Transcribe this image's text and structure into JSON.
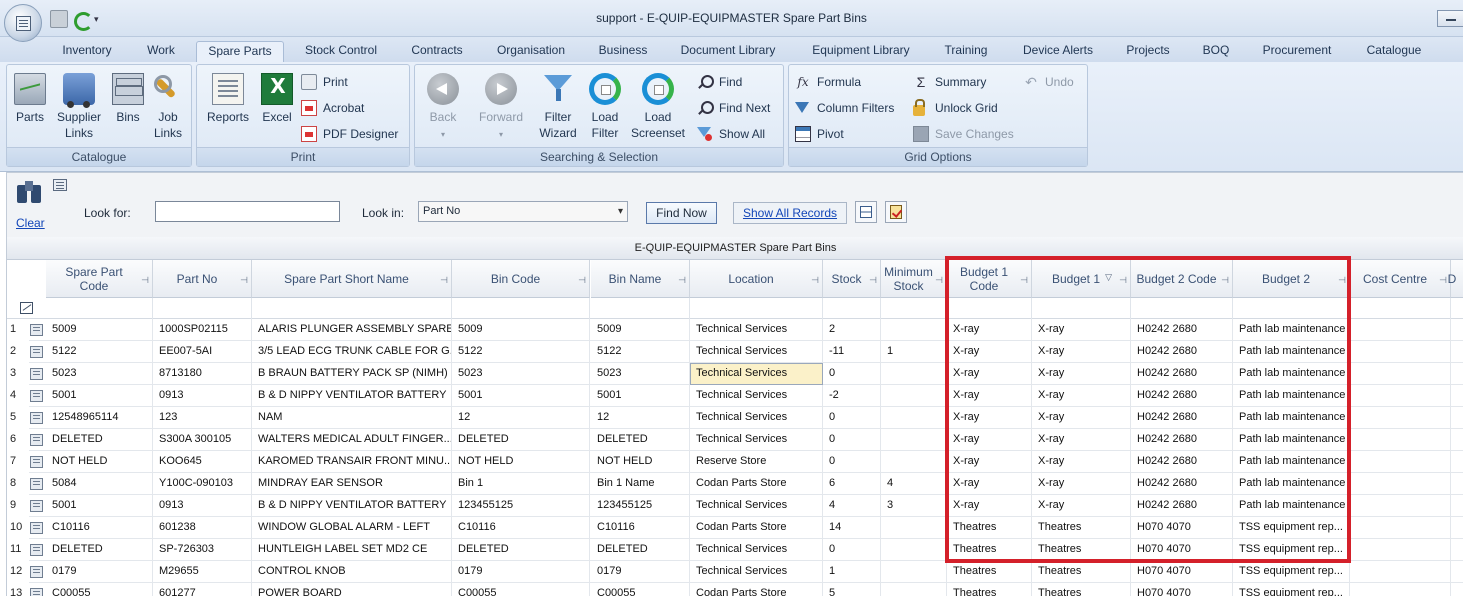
{
  "window": {
    "title": "support - E-QUIP-EQUIPMASTER Spare Part Bins"
  },
  "tabs": [
    {
      "label": "Inventory"
    },
    {
      "label": "Work"
    },
    {
      "label": "Spare Parts"
    },
    {
      "label": "Stock Control"
    },
    {
      "label": "Contracts"
    },
    {
      "label": "Organisation"
    },
    {
      "label": "Business"
    },
    {
      "label": "Document Library"
    },
    {
      "label": "Equipment Library"
    },
    {
      "label": "Training"
    },
    {
      "label": "Device Alerts"
    },
    {
      "label": "Projects"
    },
    {
      "label": "BOQ"
    },
    {
      "label": "Procurement"
    },
    {
      "label": "Catalogue"
    }
  ],
  "active_tab": "Spare Parts",
  "ribbon": {
    "catalogue": {
      "label": "Catalogue",
      "parts": "Parts",
      "supplier_links_1": "Supplier",
      "supplier_links_2": "Links",
      "bins": "Bins",
      "job_links_1": "Job",
      "job_links_2": "Links"
    },
    "print": {
      "label": "Print",
      "reports": "Reports",
      "excel": "Excel",
      "print": "Print",
      "acrobat": "Acrobat",
      "pdf_designer": "PDF Designer"
    },
    "searching": {
      "label": "Searching & Selection",
      "back": "Back",
      "forward": "Forward",
      "filter_wizard_1": "Filter",
      "filter_wizard_2": "Wizard",
      "load_filter_1": "Load",
      "load_filter_2": "Filter",
      "load_screenset_1": "Load",
      "load_screenset_2": "Screenset",
      "find": "Find",
      "find_next": "Find Next",
      "show_all": "Show All"
    },
    "grid_options": {
      "label": "Grid Options",
      "formula": "Formula",
      "column_filters": "Column Filters",
      "pivot": "Pivot",
      "summary": "Summary",
      "unlock_grid": "Unlock Grid",
      "save_changes": "Save Changes",
      "undo": "Undo"
    }
  },
  "search": {
    "clear": "Clear",
    "look_for_label": "Look for:",
    "look_for_value": "",
    "look_in_label": "Look in:",
    "look_in_value": "Part No",
    "find_now": "Find Now",
    "show_all_records": "Show All Records"
  },
  "grid": {
    "caption": "E-QUIP-EQUIPMASTER Spare Part Bins",
    "columns": [
      "Spare Part Code",
      "Part No",
      "Spare Part Short Name",
      "Bin Code",
      "Bin Name",
      "Location",
      "Stock",
      "Minimum Stock",
      "Budget 1 Code",
      "Budget 1",
      "Budget 2 Code",
      "Budget 2",
      "Cost Centre",
      "D"
    ],
    "rows": [
      {
        "n": "1",
        "code": "5009",
        "part_no": "1000SP02115",
        "name": "ALARIS PLUNGER ASSEMBLY SPARE...",
        "bin_code": "5009",
        "bin_name": "5009",
        "location": "Technical Services",
        "stock": "2",
        "min": "",
        "b1code": "X-ray",
        "b1": "X-ray",
        "b2code": "H0242 2680",
        "b2": "Path lab maintenance"
      },
      {
        "n": "2",
        "code": "5122",
        "part_no": "EE007-5AI",
        "name": "3/5 LEAD ECG TRUNK CABLE FOR G...",
        "bin_code": "5122",
        "bin_name": "5122",
        "location": "Technical Services",
        "stock": "-11",
        "min": "1",
        "b1code": "X-ray",
        "b1": "X-ray",
        "b2code": "H0242 2680",
        "b2": "Path lab maintenance"
      },
      {
        "n": "3",
        "code": "5023",
        "part_no": "8713180",
        "name": "B BRAUN BATTERY PACK SP (NIMH)",
        "bin_code": "5023",
        "bin_name": "5023",
        "location": "Technical Services",
        "stock": "0",
        "min": "",
        "b1code": "X-ray",
        "b1": "X-ray",
        "b2code": "H0242 2680",
        "b2": "Path lab maintenance"
      },
      {
        "n": "4",
        "code": "5001",
        "part_no": "0913",
        "name": "B & D NIPPY VENTILATOR BATTERY",
        "bin_code": "5001",
        "bin_name": "5001",
        "location": "Technical Services",
        "stock": "-2",
        "min": "",
        "b1code": "X-ray",
        "b1": "X-ray",
        "b2code": "H0242 2680",
        "b2": "Path lab maintenance"
      },
      {
        "n": "5",
        "code": "12548965114",
        "part_no": "123",
        "name": "NAM",
        "bin_code": "12",
        "bin_name": "12",
        "location": "Technical Services",
        "stock": "0",
        "min": "",
        "b1code": "X-ray",
        "b1": "X-ray",
        "b2code": "H0242 2680",
        "b2": "Path lab maintenance"
      },
      {
        "n": "6",
        "code": "DELETED",
        "part_no": "S300A 300105",
        "name": "WALTERS MEDICAL ADULT FINGER...",
        "bin_code": "DELETED",
        "bin_name": "DELETED",
        "location": "Technical Services",
        "stock": "0",
        "min": "",
        "b1code": "X-ray",
        "b1": "X-ray",
        "b2code": "H0242 2680",
        "b2": "Path lab maintenance"
      },
      {
        "n": "7",
        "code": "NOT HELD",
        "part_no": "KOO645",
        "name": "KAROMED TRANSAIR FRONT MINU...",
        "bin_code": "NOT HELD",
        "bin_name": "NOT HELD",
        "location": "Reserve Store",
        "stock": "0",
        "min": "",
        "b1code": "X-ray",
        "b1": "X-ray",
        "b2code": "H0242 2680",
        "b2": "Path lab maintenance"
      },
      {
        "n": "8",
        "code": "5084",
        "part_no": "Y100C-090103",
        "name": "MINDRAY EAR SENSOR",
        "bin_code": "Bin 1",
        "bin_name": "Bin 1 Name",
        "location": "Codan Parts Store",
        "stock": "6",
        "min": "4",
        "b1code": "X-ray",
        "b1": "X-ray",
        "b2code": "H0242 2680",
        "b2": "Path lab maintenance"
      },
      {
        "n": "9",
        "code": "5001",
        "part_no": "0913",
        "name": "B & D NIPPY VENTILATOR BATTERY",
        "bin_code": "123455125",
        "bin_name": "123455125",
        "location": "Technical Services",
        "stock": "4",
        "min": "3",
        "b1code": "X-ray",
        "b1": "X-ray",
        "b2code": "H0242 2680",
        "b2": "Path lab maintenance"
      },
      {
        "n": "10",
        "code": "C10116",
        "part_no": "601238",
        "name": "WINDOW GLOBAL ALARM - LEFT",
        "bin_code": "C10116",
        "bin_name": "C10116",
        "location": "Codan Parts Store",
        "stock": "14",
        "min": "",
        "b1code": "Theatres",
        "b1": "Theatres",
        "b2code": "H070 4070",
        "b2": "TSS equipment rep..."
      },
      {
        "n": "11",
        "code": "DELETED",
        "part_no": "SP-726303",
        "name": "HUNTLEIGH LABEL SET MD2 CE",
        "bin_code": "DELETED",
        "bin_name": "DELETED",
        "location": "Technical Services",
        "stock": "0",
        "min": "",
        "b1code": "Theatres",
        "b1": "Theatres",
        "b2code": "H070 4070",
        "b2": "TSS equipment rep..."
      },
      {
        "n": "12",
        "code": "0179",
        "part_no": "M29655",
        "name": "CONTROL KNOB",
        "bin_code": "0179",
        "bin_name": "0179",
        "location": "Technical Services",
        "stock": "1",
        "min": "",
        "b1code": "Theatres",
        "b1": "Theatres",
        "b2code": "H070 4070",
        "b2": "TSS equipment rep..."
      },
      {
        "n": "13",
        "code": "C00055",
        "part_no": "601277",
        "name": "POWER BOARD",
        "bin_code": "C00055",
        "bin_name": "C00055",
        "location": "Codan Parts Store",
        "stock": "5",
        "min": "",
        "b1code": "Theatres",
        "b1": "Theatres",
        "b2code": "H070 4070",
        "b2": "TSS equipment rep..."
      }
    ]
  },
  "colors": {
    "highlight": "#d4202a",
    "selected_cell": "#fbf1c9",
    "ribbon_bg": "#dde8f5"
  }
}
